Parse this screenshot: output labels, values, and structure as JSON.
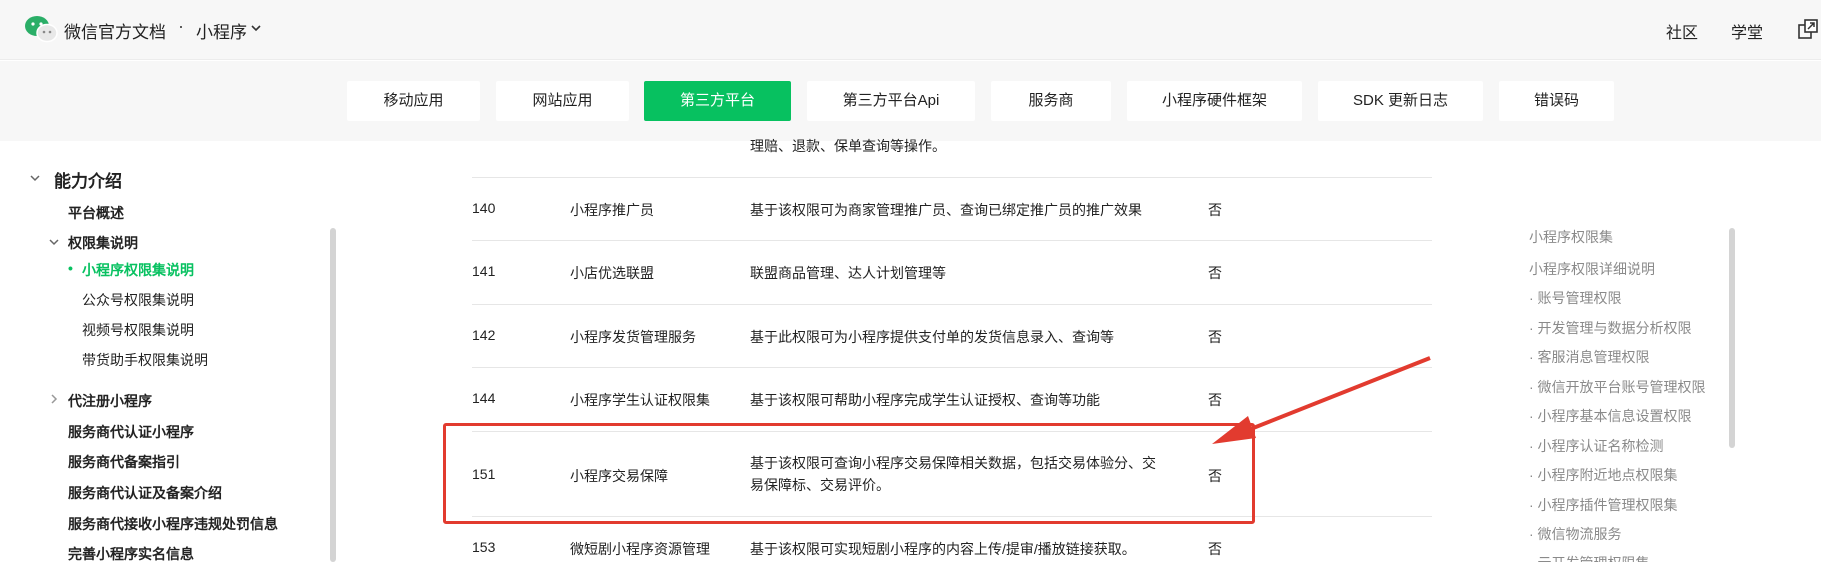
{
  "header": {
    "site_title": "微信官方文档",
    "separator": "·",
    "product": "小程序",
    "links": [
      "社区",
      "学堂"
    ]
  },
  "tabs": [
    {
      "label": "移动应用",
      "active": false
    },
    {
      "label": "网站应用",
      "active": false
    },
    {
      "label": "第三方平台",
      "active": true
    },
    {
      "label": "第三方平台Api",
      "active": false
    },
    {
      "label": "服务商",
      "active": false
    },
    {
      "label": "小程序硬件框架",
      "active": false
    },
    {
      "label": "SDK 更新日志",
      "active": false
    },
    {
      "label": "错误码",
      "active": false
    }
  ],
  "sidebar": {
    "section_title": "能力介绍",
    "items": [
      {
        "label": "平台概述"
      },
      {
        "label": "权限集说明"
      },
      {
        "label": "小程序权限集说明",
        "active": true
      },
      {
        "label": "公众号权限集说明"
      },
      {
        "label": "视频号权限集说明"
      },
      {
        "label": "带货助手权限集说明"
      },
      {
        "label": "代注册小程序"
      },
      {
        "label": "服务商代认证小程序"
      },
      {
        "label": "服务商代备案指引"
      },
      {
        "label": "服务商代认证及备案介绍"
      },
      {
        "label": "服务商代接收小程序违规处罚信息"
      },
      {
        "label": "完善小程序实名信息"
      }
    ]
  },
  "table": {
    "clipped_text": "理赔、退款、保单查询等操作。",
    "rows": [
      {
        "id": "140",
        "name": "小程序推广员",
        "desc": "基于该权限可为商家管理推广员、查询已绑定推广员的推广效果",
        "flag": "否"
      },
      {
        "id": "141",
        "name": "小店优选联盟",
        "desc": "联盟商品管理、达人计划管理等",
        "flag": "否"
      },
      {
        "id": "142",
        "name": "小程序发货管理服务",
        "desc": "基于此权限可为小程序提供支付单的发货信息录入、查询等",
        "flag": "否"
      },
      {
        "id": "144",
        "name": "小程序学生认证权限集",
        "desc": "基于该权限可帮助小程序完成学生认证授权、查询等功能",
        "flag": "否"
      },
      {
        "id": "151",
        "name": "小程序交易保障",
        "desc": "基于该权限可查询小程序交易保障相关数据，包括交易体验分、交易保障标、交易评价。",
        "flag": "否"
      },
      {
        "id": "153",
        "name": "微短剧小程序资源管理",
        "desc": "基于该权限可实现短剧小程序的内容上传/提审/播放链接获取。",
        "flag": "否"
      }
    ]
  },
  "toc": {
    "items": [
      "小程序权限集",
      "小程序权限详细说明",
      "· 账号管理权限",
      "· 开发管理与数据分析权限",
      "· 客服消息管理权限",
      "· 微信开放平台账号管理权限",
      "· 小程序基本信息设置权限",
      "· 小程序认证名称检测",
      "· 小程序附近地点权限集",
      "· 小程序插件管理权限集",
      "· 微信物流服务",
      "· 云开发管理权限集"
    ]
  },
  "colors": {
    "accent": "#07c160",
    "highlight": "#e23b2f"
  }
}
